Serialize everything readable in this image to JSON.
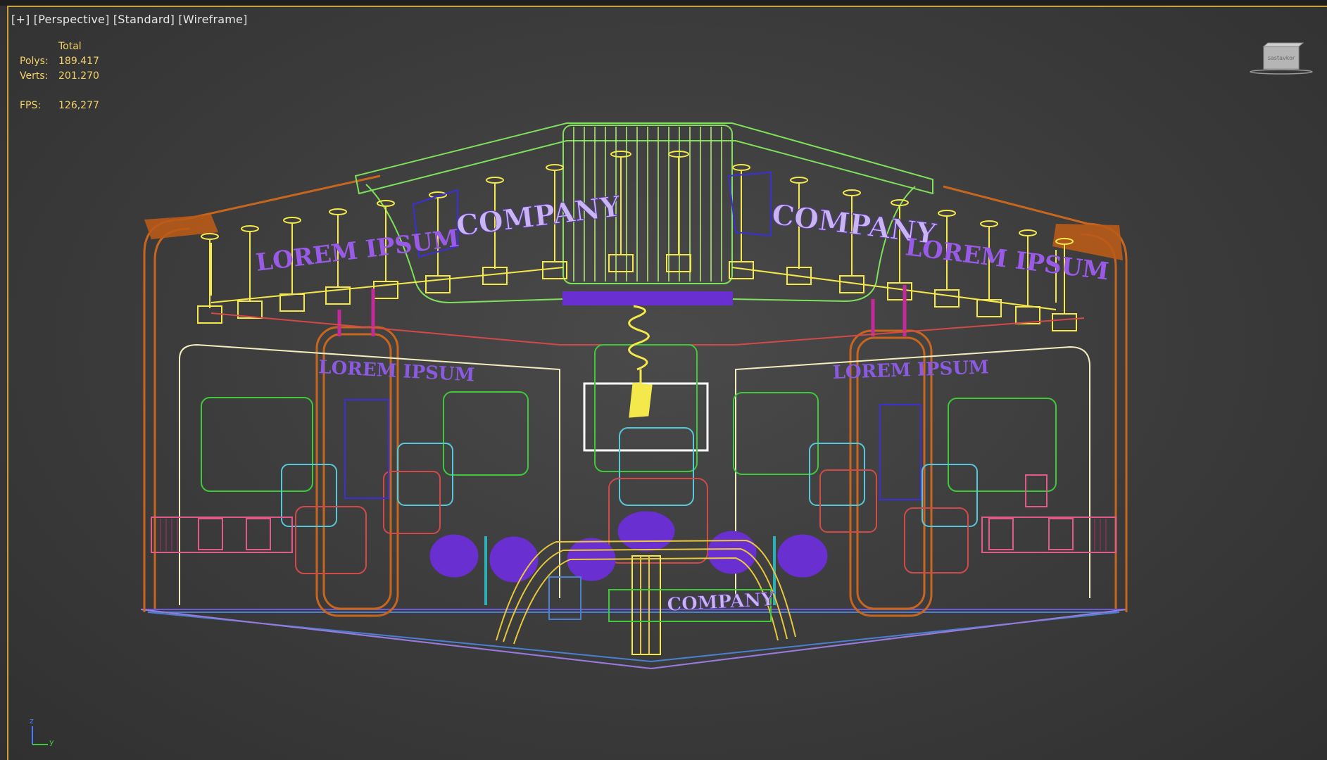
{
  "viewport": {
    "labels": [
      "[+]",
      "[Perspective]",
      "[Standard]",
      "[Wireframe]"
    ]
  },
  "stats": {
    "header": "Total",
    "polys_label": "Polys:",
    "polys_value": "189.417",
    "verts_label": "Verts:",
    "verts_value": "201.270",
    "fps_label": "FPS:",
    "fps_value": "126,277"
  },
  "scene_text": {
    "company_left": "COMPANY",
    "company_right": "COMPANY",
    "company_counter": "COMPANY",
    "lorem_top_left": "LOREM IPSUM",
    "lorem_top_right": "LOREM IPSUM",
    "lorem_wall_left": "LOREM IPSUM",
    "lorem_wall_right": "LOREM IPSUM"
  },
  "viewcube": {
    "face_label": "sastavkor"
  },
  "axis": {
    "z": "z",
    "y": "y"
  },
  "colors": {
    "background": "#3b3b3b",
    "stats_text": "#f2d36a",
    "wire_green": "#7fe05a",
    "wire_orange": "#c8661e",
    "wire_yellow": "#f4e84a",
    "wire_purple": "#6a2fd0",
    "wire_cyan": "#58c8d8",
    "wire_pink": "#e05a8a",
    "wire_red": "#d24a48",
    "active_border": "#c9a23a"
  },
  "icons": {
    "viewcube": "viewcube-icon",
    "axis_tripod": "axis-tripod-icon"
  }
}
